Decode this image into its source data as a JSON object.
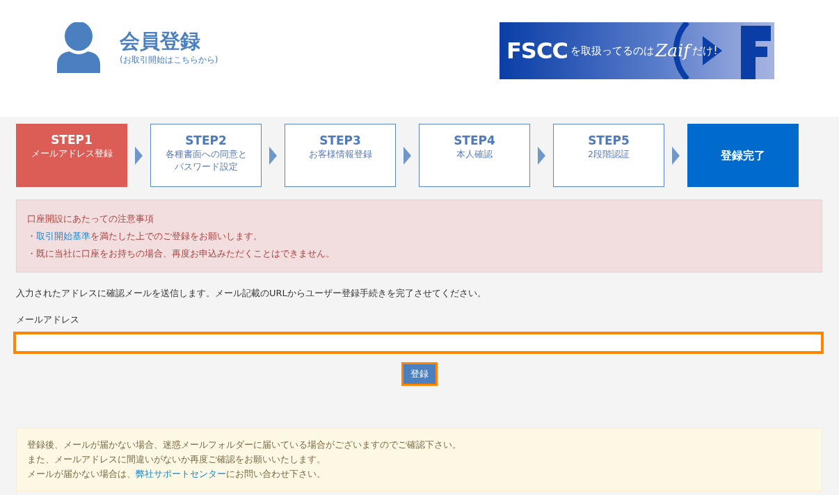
{
  "header": {
    "title": "会員登録",
    "subtitle": "(お取引開始はこちらから)"
  },
  "banner": {
    "brand": "FSCC",
    "middle": "を取扱ってるのは",
    "logo": "Zaif",
    "end": "だけ!"
  },
  "steps": [
    {
      "kind": "current",
      "label": "STEP1",
      "caption": "メールアドレス登録"
    },
    {
      "kind": "pending",
      "label": "STEP2",
      "caption": "各種書面への同意とパスワード設定"
    },
    {
      "kind": "pending",
      "label": "STEP3",
      "caption": "お客様情報登録"
    },
    {
      "kind": "pending",
      "label": "STEP4",
      "caption": "本人確認"
    },
    {
      "kind": "pending",
      "label": "STEP5",
      "caption": "2段階認証"
    },
    {
      "kind": "final",
      "label": "登録完了"
    }
  ],
  "notice": {
    "title": "口座開設にあたっての注意事項",
    "items": [
      {
        "bullet": "・",
        "link": "取引開始基準",
        "after": "を満たした上でのご登録をお願いします。"
      },
      {
        "bullet": "・",
        "before": "既に当社に口座をお持ちの場合、再度お申込みただくことはできません。"
      }
    ]
  },
  "instruction": "入力されたアドレスに確認メールを送信します。メール記載のURLからユーザー登録手続きを完了させてください。",
  "email_field": {
    "label": "メールアドレス",
    "highlighted": true
  },
  "submit_button": {
    "label": "登録",
    "highlighted": true
  },
  "info": {
    "lines": [
      {
        "before": "登録後、メールが届かない場合、迷惑メールフォルダーに届いている場合がございますのでご確認下さい。"
      },
      {
        "before": "また、メールアドレスに間違いがないか再度ご確認をお願いいたします。"
      },
      {
        "before": "メールが届かない場合は、",
        "link": "弊社サポートセンター",
        "after": "にお問い合わせ下さい。"
      }
    ]
  }
}
